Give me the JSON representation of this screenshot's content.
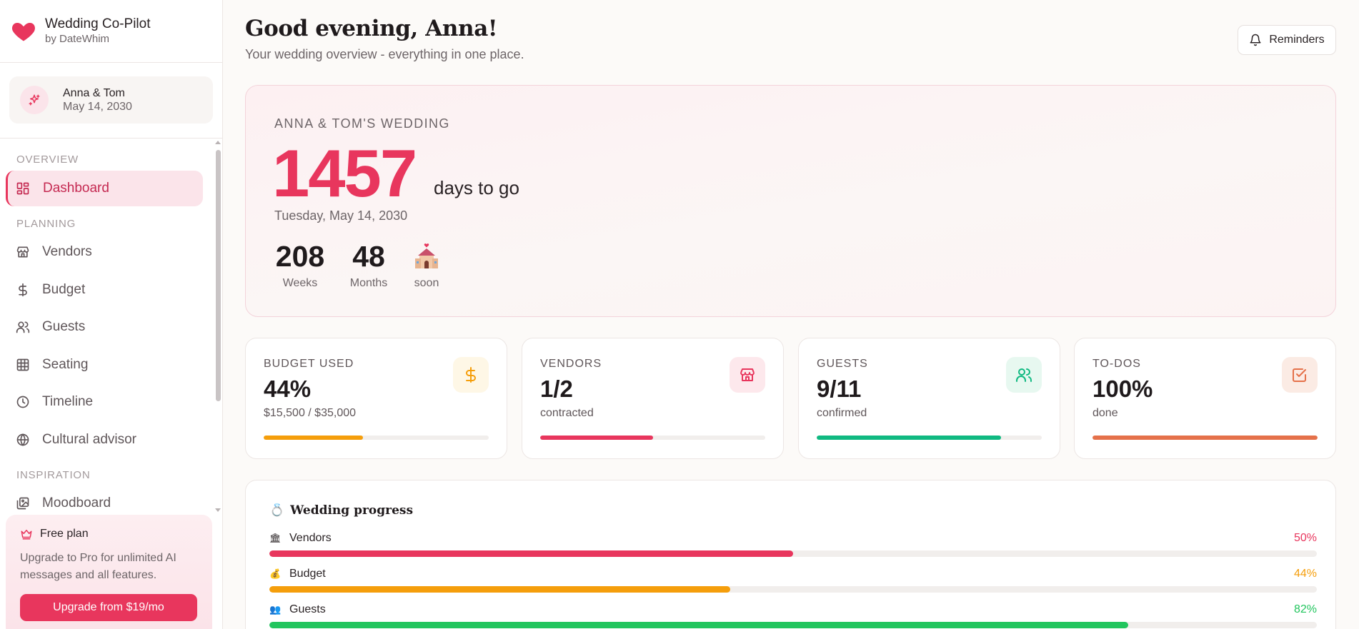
{
  "sidebar": {
    "brand": {
      "title": "Wedding Co-Pilot",
      "subtitle": "by DateWhim"
    },
    "couple": {
      "names": "Anna & Tom",
      "date": "May 14, 2030"
    },
    "sections": {
      "overview": "OVERVIEW",
      "planning": "PLANNING",
      "inspiration": "INSPIRATION"
    },
    "items": [
      {
        "label": "Dashboard",
        "icon": "layout-grid-icon",
        "active": true
      },
      {
        "label": "Vendors",
        "icon": "store-icon"
      },
      {
        "label": "Budget",
        "icon": "dollar-icon"
      },
      {
        "label": "Guests",
        "icon": "users-icon"
      },
      {
        "label": "Seating",
        "icon": "grid-icon"
      },
      {
        "label": "Timeline",
        "icon": "clock-icon"
      },
      {
        "label": "Cultural advisor",
        "icon": "globe-icon"
      },
      {
        "label": "Moodboard",
        "icon": "images-icon"
      }
    ],
    "promo": {
      "title": "Free plan",
      "text": "Upgrade to Pro for unlimited AI messages and all features.",
      "button": "Upgrade from $19/mo"
    }
  },
  "header": {
    "greeting": "Good evening, Anna!",
    "subtitle": "Your wedding overview - everything in one place.",
    "reminders": "Reminders"
  },
  "countdown": {
    "label": "ANNA & TOM'S WEDDING",
    "days": "1457",
    "days_label": "days to go",
    "date": "Tuesday, May 14, 2030",
    "weeks": "208",
    "weeks_label": "Weeks",
    "months": "48",
    "months_label": "Months",
    "soon_label": "soon"
  },
  "cards": [
    {
      "label": "BUDGET USED",
      "value": "44%",
      "sub": "$15,500 / $35,000",
      "progress": 0.44,
      "icon": "dollar-icon",
      "color": "#f59e0b",
      "icon_bg": "#fef7e6"
    },
    {
      "label": "VENDORS",
      "value": "1/2",
      "sub": "contracted",
      "progress": 0.5,
      "icon": "store-icon",
      "color": "#e8365d",
      "icon_bg": "#fde8ec"
    },
    {
      "label": "GUESTS",
      "value": "9/11",
      "sub": "confirmed",
      "progress": 0.82,
      "icon": "users-icon",
      "color": "#10b981",
      "icon_bg": "#e7f8f0"
    },
    {
      "label": "TO-DOS",
      "value": "100%",
      "sub": "done",
      "progress": 1.0,
      "icon": "check-square-icon",
      "color": "#e5714a",
      "icon_bg": "#fbebe4"
    }
  ],
  "progress": {
    "title": "Wedding progress",
    "title_emoji": "💍",
    "rows": [
      {
        "emoji": "🏛",
        "label": "Vendors",
        "pct": "50%",
        "value": 0.5,
        "color": "#e8365d"
      },
      {
        "emoji": "💰",
        "label": "Budget",
        "pct": "44%",
        "value": 0.44,
        "color": "#f59e0b"
      },
      {
        "emoji": "👥",
        "label": "Guests",
        "pct": "82%",
        "value": 0.82,
        "color": "#22c55e"
      }
    ]
  }
}
